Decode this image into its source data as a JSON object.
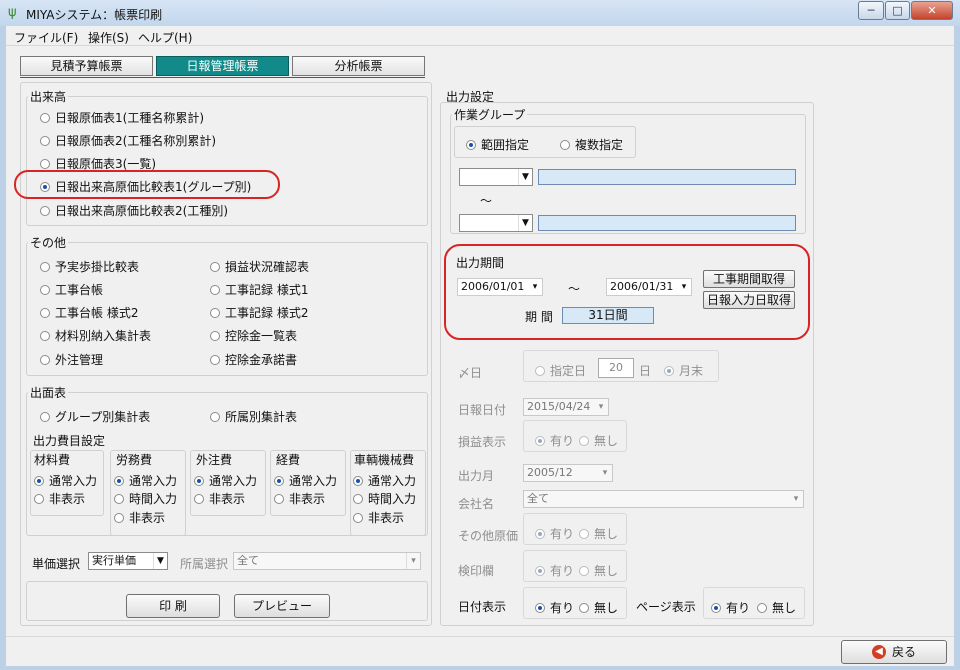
{
  "window": {
    "title": "MIYAシステム：帳票印刷",
    "min": "─",
    "max": "□",
    "close": "✕"
  },
  "menu": [
    "ファイル(F)",
    "操作(S)",
    "ヘルプ(H)"
  ],
  "tabs": [
    "見積予算帳票",
    "日報管理帳票",
    "分析帳票"
  ],
  "dekidaka": {
    "label": "出来高",
    "options": [
      "日報原価表1(工種名称累計)",
      "日報原価表2(工種名称別累計)",
      "日報原価表3(一覧)",
      "日報出来高原価比較表1(グループ別)",
      "日報出来高原価比較表2(工種別)"
    ],
    "selected": 3
  },
  "sonota": {
    "label": "その他",
    "left": [
      "予実歩掛比較表",
      "工事台帳",
      "工事台帳 様式2",
      "材料別納入集計表",
      "外注管理"
    ],
    "right": [
      "損益状況確認表",
      "工事記録 様式1",
      "工事記録 様式2",
      "控除金一覧表",
      "控除金承諾書"
    ]
  },
  "shutsumen": {
    "label": "出面表",
    "options": [
      "グループ別集計表",
      "所属別集計表"
    ],
    "hiyo_label": "出力費目設定",
    "cols": [
      {
        "title": "材料費",
        "options": [
          "通常入力",
          "非表示"
        ]
      },
      {
        "title": "労務費",
        "options": [
          "通常入力",
          "時間入力",
          "非表示"
        ]
      },
      {
        "title": "外注費",
        "options": [
          "通常入力",
          "非表示"
        ]
      },
      {
        "title": "経費",
        "options": [
          "通常入力",
          "非表示"
        ]
      },
      {
        "title": "車輌機械費",
        "options": [
          "通常入力",
          "時間入力",
          "非表示"
        ]
      }
    ]
  },
  "tanka": {
    "label": "単価選択",
    "value": "実行単価",
    "shozoku_label": "所属選択",
    "shozoku_value": "全て"
  },
  "actions": {
    "print": "印 刷",
    "preview": "プレビュー"
  },
  "output": {
    "label": "出力設定",
    "group_label": "作業グループ",
    "range": "範囲指定",
    "multi": "複数指定",
    "tilde": "～",
    "period_label": "出力期間",
    "from": "2006/01/01",
    "to": "2006/01/31",
    "btn_koji": "工事期間取得",
    "btn_nippo": "日報入力日取得",
    "kikan_label": "期 間",
    "kikan_value": "31日間",
    "shime_label": "〆日",
    "shiteibi": "指定日",
    "day_value": "20",
    "day_unit": "日",
    "getsumatsu": "月末",
    "nippo_date_label": "日報日付",
    "nippo_date": "2015/04/24",
    "soneki_label": "損益表示",
    "ari": "有り",
    "nashi": "無し",
    "month_label": "出力月",
    "month": "2005/12",
    "company_label": "会社名",
    "company": "全て",
    "other_label": "その他原価",
    "stamp_label": "検印欄",
    "date_label": "日付表示",
    "page_label": "ページ表示"
  },
  "back": "戻る"
}
